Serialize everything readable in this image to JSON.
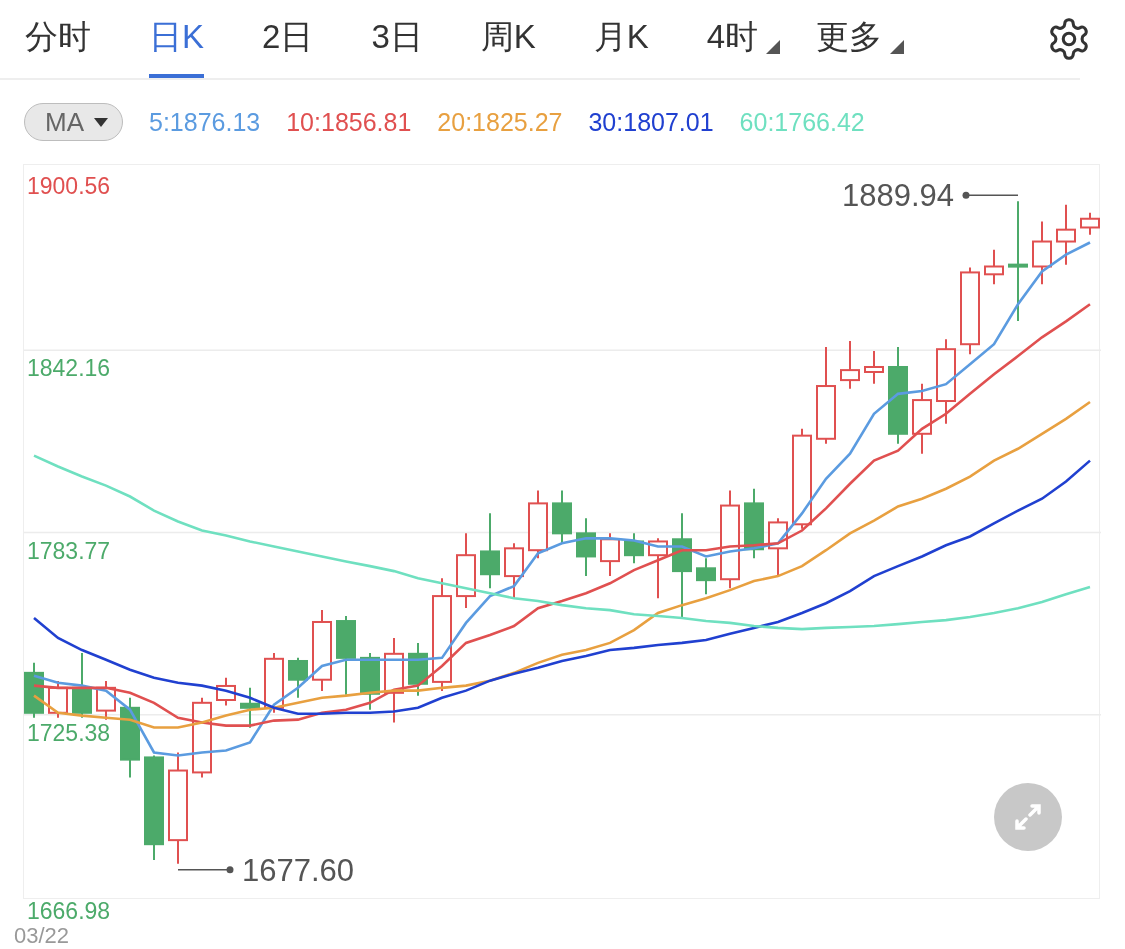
{
  "tabs": [
    {
      "label": "分时",
      "selected": false,
      "has_menu": false
    },
    {
      "label": "日K",
      "selected": true,
      "has_menu": false
    },
    {
      "label": "2日",
      "selected": false,
      "has_menu": false
    },
    {
      "label": "3日",
      "selected": false,
      "has_menu": false
    },
    {
      "label": "周K",
      "selected": false,
      "has_menu": false
    },
    {
      "label": "月K",
      "selected": false,
      "has_menu": false
    },
    {
      "label": "4时",
      "selected": false,
      "has_menu": true
    },
    {
      "label": "更多",
      "selected": false,
      "has_menu": true
    }
  ],
  "indicator_select": {
    "value": "MA"
  },
  "ma_legend": [
    {
      "label": "5:1876.13",
      "color": "#5b9be0"
    },
    {
      "label": "10:1856.81",
      "color": "#e05050"
    },
    {
      "label": "20:1825.27",
      "color": "#e8a040"
    },
    {
      "label": "30:1807.01",
      "color": "#2040d0"
    },
    {
      "label": "60:1766.42",
      "color": "#6fe0c0"
    }
  ],
  "chart_data": {
    "type": "line",
    "grid": true,
    "ylim": [
      1666.98,
      1900.56
    ],
    "yticks": [
      {
        "value": 1900.56,
        "label": "1900.56"
      },
      {
        "value": 1842.16,
        "label": "1842.16"
      },
      {
        "value": 1783.77,
        "label": "1783.77"
      },
      {
        "value": 1725.38,
        "label": "1725.38"
      },
      {
        "value": 1666.98,
        "label": "1666.98"
      }
    ],
    "series": [
      {
        "color": "#5b9be0",
        "values": [
          1737.9,
          1735.6,
          1734.7,
          1733.1,
          1727.0,
          1713.3,
          1712.3,
          1713.3,
          1713.9,
          1716.5,
          1728.6,
          1734.0,
          1741.0,
          1743.0,
          1743.0,
          1743.0,
          1743.0,
          1743.6,
          1754.8,
          1763.4,
          1766.6,
          1777.1,
          1780.3,
          1781.9,
          1781.9,
          1781.2,
          1779.3,
          1779.3,
          1776.1,
          1777.7,
          1778.7,
          1780.3,
          1789.9,
          1801.0,
          1809.0,
          1821.8,
          1828.2,
          1829.1,
          1831.3,
          1837.7,
          1844.1,
          1856.9,
          1867.4,
          1872.8,
          1876.7
        ]
      },
      {
        "color": "#e05050",
        "values": [
          1734.7,
          1734.0,
          1734.0,
          1734.0,
          1732.4,
          1729.2,
          1724.4,
          1722.9,
          1721.9,
          1721.9,
          1723.5,
          1723.8,
          1726.0,
          1727.0,
          1729.2,
          1733.4,
          1734.7,
          1741.0,
          1748.4,
          1750.9,
          1753.8,
          1759.5,
          1761.8,
          1764.3,
          1767.5,
          1771.7,
          1774.9,
          1778.1,
          1778.1,
          1779.3,
          1779.7,
          1780.3,
          1784.4,
          1791.5,
          1799.4,
          1806.8,
          1810.0,
          1817.0,
          1821.8,
          1828.2,
          1834.5,
          1840.3,
          1846.3,
          1851.4,
          1856.9
        ]
      },
      {
        "color": "#e8a040",
        "values": [
          1731.5,
          1726.0,
          1725.1,
          1724.4,
          1723.8,
          1721.3,
          1721.3,
          1722.9,
          1725.1,
          1727.0,
          1727.6,
          1729.2,
          1730.8,
          1731.5,
          1732.4,
          1733.1,
          1733.1,
          1734.0,
          1734.7,
          1736.3,
          1738.8,
          1742.0,
          1744.6,
          1746.1,
          1748.4,
          1752.5,
          1758.0,
          1760.5,
          1762.7,
          1765.3,
          1768.2,
          1769.8,
          1773.0,
          1778.1,
          1783.5,
          1787.6,
          1792.1,
          1794.6,
          1797.8,
          1801.7,
          1806.8,
          1810.6,
          1815.4,
          1820.2,
          1825.6
        ]
      },
      {
        "color": "#2040d0",
        "values": [
          1756.4,
          1750.0,
          1746.1,
          1743.0,
          1739.8,
          1737.2,
          1735.6,
          1734.7,
          1733.1,
          1730.8,
          1727.6,
          1725.7,
          1725.7,
          1726.0,
          1726.0,
          1726.4,
          1727.6,
          1730.8,
          1733.1,
          1736.3,
          1738.5,
          1740.4,
          1742.6,
          1744.2,
          1746.1,
          1746.8,
          1747.7,
          1748.4,
          1749.3,
          1751.3,
          1753.2,
          1755.1,
          1758.0,
          1761.1,
          1765.0,
          1769.8,
          1773.0,
          1776.1,
          1779.7,
          1782.5,
          1786.7,
          1790.8,
          1794.6,
          1800.1,
          1806.8
        ]
      },
      {
        "color": "#6fe0c0",
        "values": [
          1808.4,
          1804.9,
          1801.7,
          1798.8,
          1795.3,
          1790.8,
          1787.3,
          1784.4,
          1782.8,
          1780.9,
          1779.3,
          1777.7,
          1776.1,
          1774.5,
          1773.0,
          1771.4,
          1769.1,
          1767.5,
          1765.9,
          1764.3,
          1762.7,
          1761.8,
          1760.5,
          1759.5,
          1758.9,
          1757.6,
          1757.0,
          1756.4,
          1755.4,
          1754.8,
          1753.8,
          1753.2,
          1752.8,
          1753.2,
          1753.5,
          1753.8,
          1754.4,
          1755.1,
          1755.7,
          1756.7,
          1758.0,
          1759.5,
          1761.5,
          1764.0,
          1766.3
        ]
      }
    ],
    "annotations": [
      "1889.94",
      "1677.60"
    ]
  },
  "x_start_label": "03/22"
}
